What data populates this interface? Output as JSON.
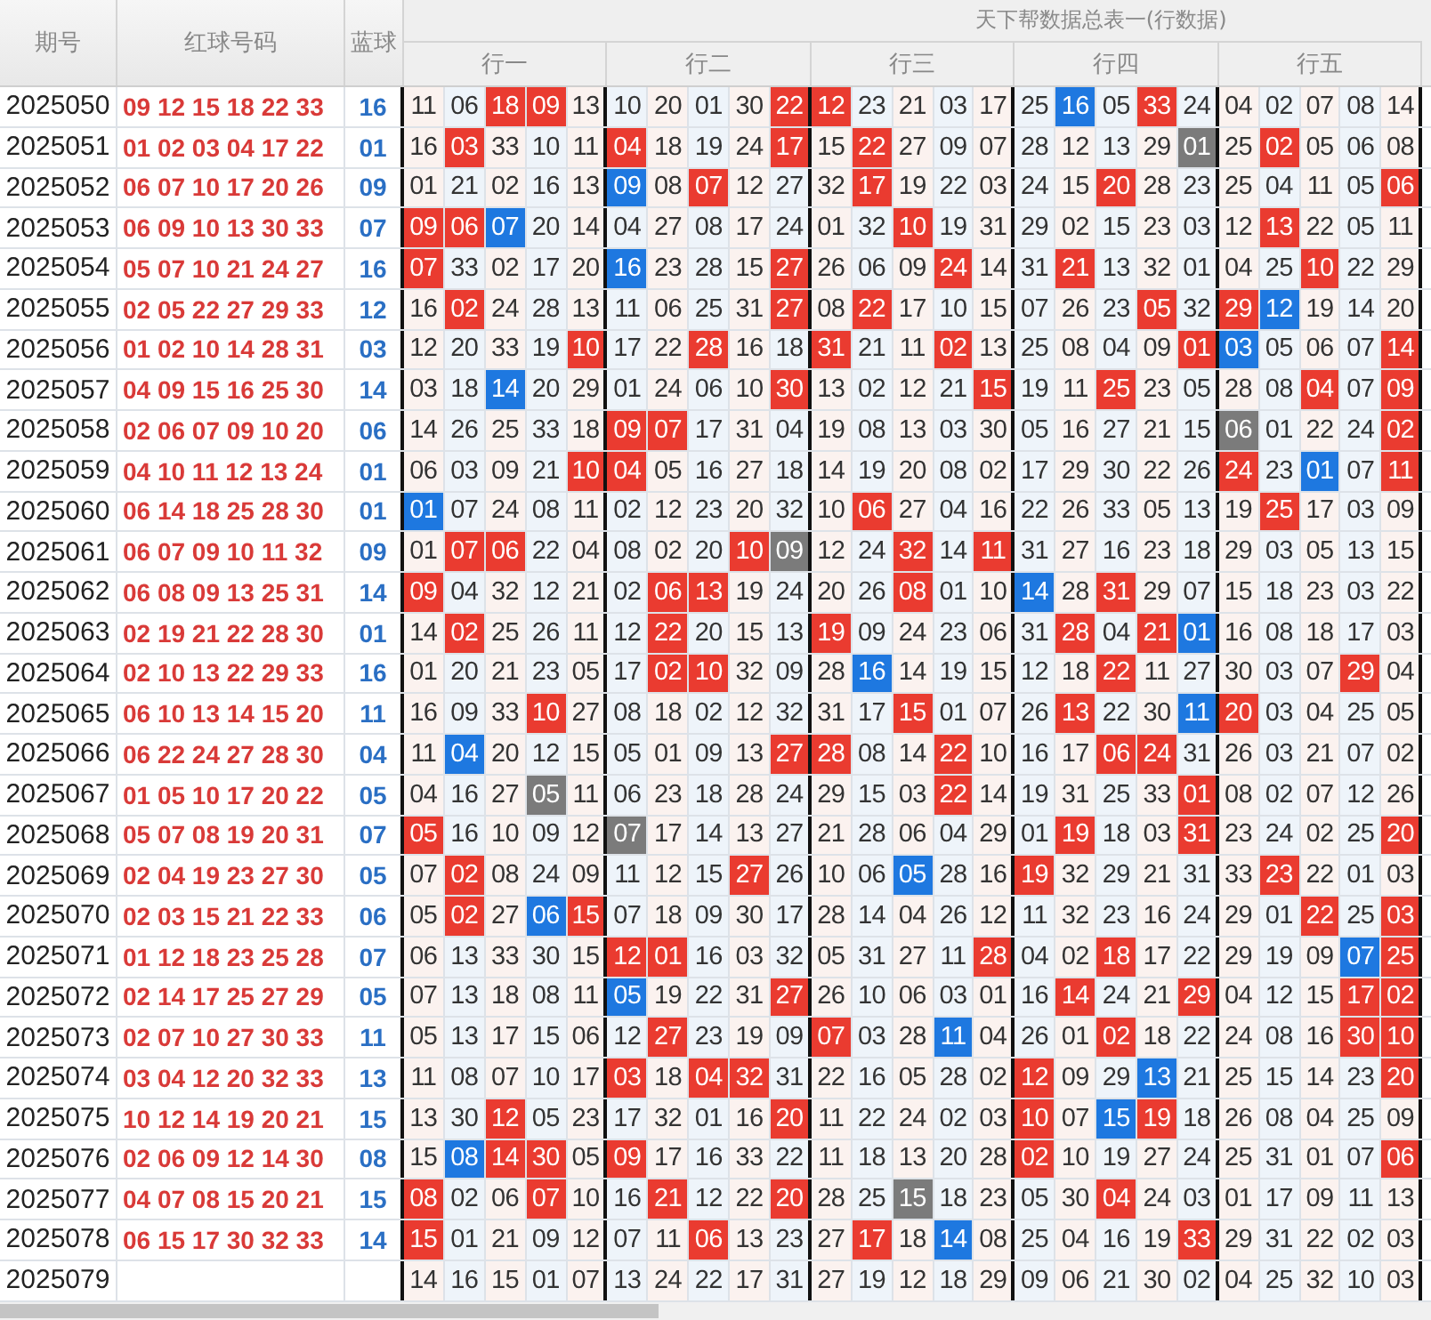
{
  "title": "天下帮数据总表一(行数据)",
  "columns": [
    "期号",
    "红球号码",
    "蓝球"
  ],
  "groups": [
    "行一",
    "行二",
    "行三",
    "行四",
    "行五"
  ],
  "rows": [
    {
      "issue": "2025050",
      "red": "09 12 15 18 22 33",
      "blue": "16",
      "cells": [
        {
          "v": "11"
        },
        {
          "v": "06"
        },
        {
          "v": "18",
          "red_hit": true
        },
        {
          "v": "09",
          "red_hit": true
        },
        {
          "v": "13"
        },
        {
          "v": "10"
        },
        {
          "v": "20"
        },
        {
          "v": "01"
        },
        {
          "v": "30"
        },
        {
          "v": "22",
          "red_hit": true
        },
        {
          "v": "12",
          "red_hit": true
        },
        {
          "v": "23"
        },
        {
          "v": "21"
        },
        {
          "v": "03"
        },
        {
          "v": "17"
        },
        {
          "v": "25"
        },
        {
          "v": "16",
          "blue_hit": true
        },
        {
          "v": "05"
        },
        {
          "v": "33",
          "red_hit": true
        },
        {
          "v": "24"
        },
        {
          "v": "04"
        },
        {
          "v": "02"
        },
        {
          "v": "07"
        },
        {
          "v": "08"
        },
        {
          "v": "14"
        }
      ]
    },
    {
      "issue": "2025051",
      "red": "01 02 03 04 17 22",
      "blue": "01",
      "cells": [
        {
          "v": "16"
        },
        {
          "v": "03",
          "red_hit": true
        },
        {
          "v": "33"
        },
        {
          "v": "10"
        },
        {
          "v": "11"
        },
        {
          "v": "04",
          "red_hit": true
        },
        {
          "v": "18"
        },
        {
          "v": "19"
        },
        {
          "v": "24"
        },
        {
          "v": "17",
          "red_hit": true
        },
        {
          "v": "15"
        },
        {
          "v": "22",
          "red_hit": true
        },
        {
          "v": "27"
        },
        {
          "v": "09"
        },
        {
          "v": "07"
        },
        {
          "v": "28"
        },
        {
          "v": "12"
        },
        {
          "v": "13"
        },
        {
          "v": "29"
        },
        {
          "v": "01",
          "gray_hit": true
        },
        {
          "v": "25"
        },
        {
          "v": "02",
          "red_hit": true
        },
        {
          "v": "05"
        },
        {
          "v": "06"
        },
        {
          "v": "08"
        }
      ]
    },
    {
      "issue": "2025052",
      "red": "06 07 10 17 20 26",
      "blue": "09",
      "cells": [
        {
          "v": "01"
        },
        {
          "v": "21"
        },
        {
          "v": "02"
        },
        {
          "v": "16"
        },
        {
          "v": "13"
        },
        {
          "v": "09",
          "blue_hit": true
        },
        {
          "v": "08"
        },
        {
          "v": "07",
          "red_hit": true
        },
        {
          "v": "12"
        },
        {
          "v": "27"
        },
        {
          "v": "32"
        },
        {
          "v": "17",
          "red_hit": true
        },
        {
          "v": "19"
        },
        {
          "v": "22"
        },
        {
          "v": "03"
        },
        {
          "v": "24"
        },
        {
          "v": "15"
        },
        {
          "v": "20",
          "red_hit": true
        },
        {
          "v": "28"
        },
        {
          "v": "23"
        },
        {
          "v": "25"
        },
        {
          "v": "04"
        },
        {
          "v": "11"
        },
        {
          "v": "05"
        },
        {
          "v": "06",
          "red_hit": true
        }
      ]
    },
    {
      "issue": "2025053",
      "red": "06 09 10 13 30 33",
      "blue": "07",
      "cells": [
        {
          "v": "09",
          "red_hit": true
        },
        {
          "v": "06",
          "red_hit": true
        },
        {
          "v": "07",
          "blue_hit": true
        },
        {
          "v": "20"
        },
        {
          "v": "14"
        },
        {
          "v": "04"
        },
        {
          "v": "27"
        },
        {
          "v": "08"
        },
        {
          "v": "17"
        },
        {
          "v": "24"
        },
        {
          "v": "01"
        },
        {
          "v": "32"
        },
        {
          "v": "10",
          "red_hit": true
        },
        {
          "v": "19"
        },
        {
          "v": "31"
        },
        {
          "v": "29"
        },
        {
          "v": "02"
        },
        {
          "v": "15"
        },
        {
          "v": "23"
        },
        {
          "v": "03"
        },
        {
          "v": "12"
        },
        {
          "v": "13",
          "red_hit": true
        },
        {
          "v": "22"
        },
        {
          "v": "05"
        },
        {
          "v": "11"
        }
      ]
    },
    {
      "issue": "2025054",
      "red": "05 07 10 21 24 27",
      "blue": "16",
      "cells": [
        {
          "v": "07",
          "red_hit": true
        },
        {
          "v": "33"
        },
        {
          "v": "02"
        },
        {
          "v": "17"
        },
        {
          "v": "20"
        },
        {
          "v": "16",
          "blue_hit": true
        },
        {
          "v": "23"
        },
        {
          "v": "28"
        },
        {
          "v": "15"
        },
        {
          "v": "27",
          "red_hit": true
        },
        {
          "v": "26"
        },
        {
          "v": "06"
        },
        {
          "v": "09"
        },
        {
          "v": "24",
          "red_hit": true
        },
        {
          "v": "14"
        },
        {
          "v": "31"
        },
        {
          "v": "21",
          "red_hit": true
        },
        {
          "v": "13"
        },
        {
          "v": "32"
        },
        {
          "v": "01"
        },
        {
          "v": "04"
        },
        {
          "v": "25"
        },
        {
          "v": "10",
          "red_hit": true
        },
        {
          "v": "22"
        },
        {
          "v": "29"
        }
      ]
    },
    {
      "issue": "2025055",
      "red": "02 05 22 27 29 33",
      "blue": "12",
      "cells": [
        {
          "v": "16"
        },
        {
          "v": "02",
          "red_hit": true
        },
        {
          "v": "24"
        },
        {
          "v": "28"
        },
        {
          "v": "13"
        },
        {
          "v": "11"
        },
        {
          "v": "06"
        },
        {
          "v": "25"
        },
        {
          "v": "31"
        },
        {
          "v": "27",
          "red_hit": true
        },
        {
          "v": "08"
        },
        {
          "v": "22",
          "red_hit": true
        },
        {
          "v": "17"
        },
        {
          "v": "10"
        },
        {
          "v": "15"
        },
        {
          "v": "07"
        },
        {
          "v": "26"
        },
        {
          "v": "23"
        },
        {
          "v": "05",
          "red_hit": true
        },
        {
          "v": "32"
        },
        {
          "v": "29",
          "red_hit": true
        },
        {
          "v": "12",
          "blue_hit": true
        },
        {
          "v": "19"
        },
        {
          "v": "14"
        },
        {
          "v": "20"
        }
      ]
    },
    {
      "issue": "2025056",
      "red": "01 02 10 14 28 31",
      "blue": "03",
      "cells": [
        {
          "v": "12"
        },
        {
          "v": "20"
        },
        {
          "v": "33"
        },
        {
          "v": "19"
        },
        {
          "v": "10",
          "red_hit": true
        },
        {
          "v": "17"
        },
        {
          "v": "22"
        },
        {
          "v": "28",
          "red_hit": true
        },
        {
          "v": "16"
        },
        {
          "v": "18"
        },
        {
          "v": "31",
          "red_hit": true
        },
        {
          "v": "21"
        },
        {
          "v": "11"
        },
        {
          "v": "02",
          "red_hit": true
        },
        {
          "v": "13"
        },
        {
          "v": "25"
        },
        {
          "v": "08"
        },
        {
          "v": "04"
        },
        {
          "v": "09"
        },
        {
          "v": "01",
          "red_hit": true
        },
        {
          "v": "03",
          "blue_hit": true
        },
        {
          "v": "05"
        },
        {
          "v": "06"
        },
        {
          "v": "07"
        },
        {
          "v": "14",
          "red_hit": true
        }
      ]
    },
    {
      "issue": "2025057",
      "red": "04 09 15 16 25 30",
      "blue": "14",
      "cells": [
        {
          "v": "03"
        },
        {
          "v": "18"
        },
        {
          "v": "14",
          "blue_hit": true
        },
        {
          "v": "20"
        },
        {
          "v": "29"
        },
        {
          "v": "01"
        },
        {
          "v": "24"
        },
        {
          "v": "06"
        },
        {
          "v": "10"
        },
        {
          "v": "30",
          "red_hit": true
        },
        {
          "v": "13"
        },
        {
          "v": "02"
        },
        {
          "v": "12"
        },
        {
          "v": "21"
        },
        {
          "v": "15",
          "red_hit": true
        },
        {
          "v": "19"
        },
        {
          "v": "11"
        },
        {
          "v": "25",
          "red_hit": true
        },
        {
          "v": "23"
        },
        {
          "v": "05"
        },
        {
          "v": "28"
        },
        {
          "v": "08"
        },
        {
          "v": "04",
          "red_hit": true
        },
        {
          "v": "07"
        },
        {
          "v": "09",
          "red_hit": true
        }
      ]
    },
    {
      "issue": "2025058",
      "red": "02 06 07 09 10 20",
      "blue": "06",
      "cells": [
        {
          "v": "14"
        },
        {
          "v": "26"
        },
        {
          "v": "25"
        },
        {
          "v": "33"
        },
        {
          "v": "18"
        },
        {
          "v": "09",
          "red_hit": true
        },
        {
          "v": "07",
          "red_hit": true
        },
        {
          "v": "17"
        },
        {
          "v": "31"
        },
        {
          "v": "04"
        },
        {
          "v": "19"
        },
        {
          "v": "08"
        },
        {
          "v": "13"
        },
        {
          "v": "03"
        },
        {
          "v": "30"
        },
        {
          "v": "05"
        },
        {
          "v": "16"
        },
        {
          "v": "27"
        },
        {
          "v": "21"
        },
        {
          "v": "15"
        },
        {
          "v": "06",
          "gray_hit": true
        },
        {
          "v": "01"
        },
        {
          "v": "22"
        },
        {
          "v": "24"
        },
        {
          "v": "02",
          "red_hit": true
        }
      ]
    },
    {
      "issue": "2025059",
      "red": "04 10 11 12 13 24",
      "blue": "01",
      "cells": [
        {
          "v": "06"
        },
        {
          "v": "03"
        },
        {
          "v": "09"
        },
        {
          "v": "21"
        },
        {
          "v": "10",
          "red_hit": true
        },
        {
          "v": "04",
          "red_hit": true
        },
        {
          "v": "05"
        },
        {
          "v": "16"
        },
        {
          "v": "27"
        },
        {
          "v": "18"
        },
        {
          "v": "14"
        },
        {
          "v": "19"
        },
        {
          "v": "20"
        },
        {
          "v": "08"
        },
        {
          "v": "02"
        },
        {
          "v": "17"
        },
        {
          "v": "29"
        },
        {
          "v": "30"
        },
        {
          "v": "22"
        },
        {
          "v": "26"
        },
        {
          "v": "24",
          "red_hit": true
        },
        {
          "v": "23"
        },
        {
          "v": "01",
          "blue_hit": true
        },
        {
          "v": "07"
        },
        {
          "v": "11",
          "red_hit": true
        }
      ]
    },
    {
      "issue": "2025060",
      "red": "06 14 18 25 28 30",
      "blue": "01",
      "cells": [
        {
          "v": "01",
          "blue_hit": true
        },
        {
          "v": "07"
        },
        {
          "v": "24"
        },
        {
          "v": "08"
        },
        {
          "v": "11"
        },
        {
          "v": "02"
        },
        {
          "v": "12"
        },
        {
          "v": "23"
        },
        {
          "v": "20"
        },
        {
          "v": "32"
        },
        {
          "v": "10"
        },
        {
          "v": "06",
          "red_hit": true
        },
        {
          "v": "27"
        },
        {
          "v": "04"
        },
        {
          "v": "16"
        },
        {
          "v": "22"
        },
        {
          "v": "26"
        },
        {
          "v": "33"
        },
        {
          "v": "05"
        },
        {
          "v": "13"
        },
        {
          "v": "19"
        },
        {
          "v": "25",
          "red_hit": true
        },
        {
          "v": "17"
        },
        {
          "v": "03"
        },
        {
          "v": "09"
        }
      ]
    },
    {
      "issue": "2025061",
      "red": "06 07 09 10 11 32",
      "blue": "09",
      "cells": [
        {
          "v": "01"
        },
        {
          "v": "07",
          "red_hit": true
        },
        {
          "v": "06",
          "red_hit": true
        },
        {
          "v": "22"
        },
        {
          "v": "04"
        },
        {
          "v": "08"
        },
        {
          "v": "02"
        },
        {
          "v": "20"
        },
        {
          "v": "10",
          "red_hit": true
        },
        {
          "v": "09",
          "gray_hit": true
        },
        {
          "v": "12"
        },
        {
          "v": "24"
        },
        {
          "v": "32",
          "red_hit": true
        },
        {
          "v": "14"
        },
        {
          "v": "11",
          "red_hit": true
        },
        {
          "v": "31"
        },
        {
          "v": "27"
        },
        {
          "v": "16"
        },
        {
          "v": "23"
        },
        {
          "v": "18"
        },
        {
          "v": "29"
        },
        {
          "v": "03"
        },
        {
          "v": "05"
        },
        {
          "v": "13"
        },
        {
          "v": "15"
        }
      ]
    },
    {
      "issue": "2025062",
      "red": "06 08 09 13 25 31",
      "blue": "14",
      "cells": [
        {
          "v": "09",
          "red_hit": true
        },
        {
          "v": "04"
        },
        {
          "v": "32"
        },
        {
          "v": "12"
        },
        {
          "v": "21"
        },
        {
          "v": "02"
        },
        {
          "v": "06",
          "red_hit": true
        },
        {
          "v": "13",
          "red_hit": true
        },
        {
          "v": "19"
        },
        {
          "v": "24"
        },
        {
          "v": "20"
        },
        {
          "v": "26"
        },
        {
          "v": "08",
          "red_hit": true
        },
        {
          "v": "01"
        },
        {
          "v": "10"
        },
        {
          "v": "14",
          "blue_hit": true
        },
        {
          "v": "28"
        },
        {
          "v": "31",
          "red_hit": true
        },
        {
          "v": "29"
        },
        {
          "v": "07"
        },
        {
          "v": "15"
        },
        {
          "v": "18"
        },
        {
          "v": "23"
        },
        {
          "v": "03"
        },
        {
          "v": "22"
        }
      ]
    },
    {
      "issue": "2025063",
      "red": "02 19 21 22 28 30",
      "blue": "01",
      "cells": [
        {
          "v": "14"
        },
        {
          "v": "02",
          "red_hit": true
        },
        {
          "v": "25"
        },
        {
          "v": "26"
        },
        {
          "v": "11"
        },
        {
          "v": "12"
        },
        {
          "v": "22",
          "red_hit": true
        },
        {
          "v": "20"
        },
        {
          "v": "15"
        },
        {
          "v": "13"
        },
        {
          "v": "19",
          "red_hit": true
        },
        {
          "v": "09"
        },
        {
          "v": "24"
        },
        {
          "v": "23"
        },
        {
          "v": "06"
        },
        {
          "v": "31"
        },
        {
          "v": "28",
          "red_hit": true
        },
        {
          "v": "04"
        },
        {
          "v": "21",
          "red_hit": true
        },
        {
          "v": "01",
          "blue_hit": true
        },
        {
          "v": "16"
        },
        {
          "v": "08"
        },
        {
          "v": "18"
        },
        {
          "v": "17"
        },
        {
          "v": "03"
        }
      ]
    },
    {
      "issue": "2025064",
      "red": "02 10 13 22 29 33",
      "blue": "16",
      "cells": [
        {
          "v": "01"
        },
        {
          "v": "20"
        },
        {
          "v": "21"
        },
        {
          "v": "23"
        },
        {
          "v": "05"
        },
        {
          "v": "17"
        },
        {
          "v": "02",
          "red_hit": true
        },
        {
          "v": "10",
          "red_hit": true
        },
        {
          "v": "32"
        },
        {
          "v": "09"
        },
        {
          "v": "28"
        },
        {
          "v": "16",
          "blue_hit": true
        },
        {
          "v": "14"
        },
        {
          "v": "19"
        },
        {
          "v": "15"
        },
        {
          "v": "12"
        },
        {
          "v": "18"
        },
        {
          "v": "22",
          "red_hit": true
        },
        {
          "v": "11"
        },
        {
          "v": "27"
        },
        {
          "v": "30"
        },
        {
          "v": "03"
        },
        {
          "v": "07"
        },
        {
          "v": "29",
          "red_hit": true
        },
        {
          "v": "04"
        }
      ]
    },
    {
      "issue": "2025065",
      "red": "06 10 13 14 15 20",
      "blue": "11",
      "cells": [
        {
          "v": "16"
        },
        {
          "v": "09"
        },
        {
          "v": "33"
        },
        {
          "v": "10",
          "red_hit": true
        },
        {
          "v": "27"
        },
        {
          "v": "08"
        },
        {
          "v": "18"
        },
        {
          "v": "02"
        },
        {
          "v": "12"
        },
        {
          "v": "32"
        },
        {
          "v": "31"
        },
        {
          "v": "17"
        },
        {
          "v": "15",
          "red_hit": true
        },
        {
          "v": "01"
        },
        {
          "v": "07"
        },
        {
          "v": "26"
        },
        {
          "v": "13",
          "red_hit": true
        },
        {
          "v": "22"
        },
        {
          "v": "30"
        },
        {
          "v": "11",
          "blue_hit": true
        },
        {
          "v": "20",
          "red_hit": true
        },
        {
          "v": "03"
        },
        {
          "v": "04"
        },
        {
          "v": "25"
        },
        {
          "v": "05"
        }
      ]
    },
    {
      "issue": "2025066",
      "red": "06 22 24 27 28 30",
      "blue": "04",
      "cells": [
        {
          "v": "11"
        },
        {
          "v": "04",
          "blue_hit": true
        },
        {
          "v": "20"
        },
        {
          "v": "12"
        },
        {
          "v": "15"
        },
        {
          "v": "05"
        },
        {
          "v": "01"
        },
        {
          "v": "09"
        },
        {
          "v": "13"
        },
        {
          "v": "27",
          "red_hit": true
        },
        {
          "v": "28",
          "red_hit": true
        },
        {
          "v": "08"
        },
        {
          "v": "14"
        },
        {
          "v": "22",
          "red_hit": true
        },
        {
          "v": "10"
        },
        {
          "v": "16"
        },
        {
          "v": "17"
        },
        {
          "v": "06",
          "red_hit": true
        },
        {
          "v": "24",
          "red_hit": true
        },
        {
          "v": "31"
        },
        {
          "v": "26"
        },
        {
          "v": "03"
        },
        {
          "v": "21"
        },
        {
          "v": "07"
        },
        {
          "v": "02"
        }
      ]
    },
    {
      "issue": "2025067",
      "red": "01 05 10 17 20 22",
      "blue": "05",
      "cells": [
        {
          "v": "04"
        },
        {
          "v": "16"
        },
        {
          "v": "27"
        },
        {
          "v": "05",
          "gray_hit": true
        },
        {
          "v": "11"
        },
        {
          "v": "06"
        },
        {
          "v": "23"
        },
        {
          "v": "18"
        },
        {
          "v": "28"
        },
        {
          "v": "24"
        },
        {
          "v": "29"
        },
        {
          "v": "15"
        },
        {
          "v": "03"
        },
        {
          "v": "22",
          "red_hit": true
        },
        {
          "v": "14"
        },
        {
          "v": "19"
        },
        {
          "v": "31"
        },
        {
          "v": "25"
        },
        {
          "v": "33"
        },
        {
          "v": "01",
          "red_hit": true
        },
        {
          "v": "08"
        },
        {
          "v": "02"
        },
        {
          "v": "07"
        },
        {
          "v": "12"
        },
        {
          "v": "26"
        }
      ]
    },
    {
      "issue": "2025068",
      "red": "05 07 08 19 20 31",
      "blue": "07",
      "cells": [
        {
          "v": "05",
          "red_hit": true
        },
        {
          "v": "16"
        },
        {
          "v": "10"
        },
        {
          "v": "09"
        },
        {
          "v": "12"
        },
        {
          "v": "07",
          "gray_hit": true
        },
        {
          "v": "17"
        },
        {
          "v": "14"
        },
        {
          "v": "13"
        },
        {
          "v": "27"
        },
        {
          "v": "21"
        },
        {
          "v": "28"
        },
        {
          "v": "06"
        },
        {
          "v": "04"
        },
        {
          "v": "29"
        },
        {
          "v": "01"
        },
        {
          "v": "19",
          "red_hit": true
        },
        {
          "v": "18"
        },
        {
          "v": "03"
        },
        {
          "v": "31",
          "red_hit": true
        },
        {
          "v": "23"
        },
        {
          "v": "24"
        },
        {
          "v": "02"
        },
        {
          "v": "25"
        },
        {
          "v": "20",
          "red_hit": true
        }
      ]
    },
    {
      "issue": "2025069",
      "red": "02 04 19 23 27 30",
      "blue": "05",
      "cells": [
        {
          "v": "07"
        },
        {
          "v": "02",
          "red_hit": true
        },
        {
          "v": "08"
        },
        {
          "v": "24"
        },
        {
          "v": "09"
        },
        {
          "v": "11"
        },
        {
          "v": "12"
        },
        {
          "v": "15"
        },
        {
          "v": "27",
          "red_hit": true
        },
        {
          "v": "26"
        },
        {
          "v": "10"
        },
        {
          "v": "06"
        },
        {
          "v": "05",
          "blue_hit": true
        },
        {
          "v": "28"
        },
        {
          "v": "16"
        },
        {
          "v": "19",
          "red_hit": true
        },
        {
          "v": "32"
        },
        {
          "v": "29"
        },
        {
          "v": "21"
        },
        {
          "v": "31"
        },
        {
          "v": "33"
        },
        {
          "v": "23",
          "red_hit": true
        },
        {
          "v": "22"
        },
        {
          "v": "01"
        },
        {
          "v": "03"
        }
      ]
    },
    {
      "issue": "2025070",
      "red": "02 03 15 21 22 33",
      "blue": "06",
      "cells": [
        {
          "v": "05"
        },
        {
          "v": "02",
          "red_hit": true
        },
        {
          "v": "27"
        },
        {
          "v": "06",
          "blue_hit": true
        },
        {
          "v": "15",
          "red_hit": true
        },
        {
          "v": "07"
        },
        {
          "v": "18"
        },
        {
          "v": "09"
        },
        {
          "v": "30"
        },
        {
          "v": "17"
        },
        {
          "v": "28"
        },
        {
          "v": "14"
        },
        {
          "v": "04"
        },
        {
          "v": "26"
        },
        {
          "v": "12"
        },
        {
          "v": "11"
        },
        {
          "v": "32"
        },
        {
          "v": "23"
        },
        {
          "v": "16"
        },
        {
          "v": "24"
        },
        {
          "v": "29"
        },
        {
          "v": "01"
        },
        {
          "v": "22",
          "red_hit": true
        },
        {
          "v": "25"
        },
        {
          "v": "03",
          "red_hit": true
        }
      ]
    },
    {
      "issue": "2025071",
      "red": "01 12 18 23 25 28",
      "blue": "07",
      "cells": [
        {
          "v": "06"
        },
        {
          "v": "13"
        },
        {
          "v": "33"
        },
        {
          "v": "30"
        },
        {
          "v": "15"
        },
        {
          "v": "12",
          "red_hit": true
        },
        {
          "v": "01",
          "red_hit": true
        },
        {
          "v": "16"
        },
        {
          "v": "03"
        },
        {
          "v": "32"
        },
        {
          "v": "05"
        },
        {
          "v": "31"
        },
        {
          "v": "27"
        },
        {
          "v": "11"
        },
        {
          "v": "28",
          "red_hit": true
        },
        {
          "v": "04"
        },
        {
          "v": "02"
        },
        {
          "v": "18",
          "red_hit": true
        },
        {
          "v": "17"
        },
        {
          "v": "22"
        },
        {
          "v": "29"
        },
        {
          "v": "19"
        },
        {
          "v": "09"
        },
        {
          "v": "07",
          "blue_hit": true
        },
        {
          "v": "25",
          "red_hit": true
        }
      ]
    },
    {
      "issue": "2025072",
      "red": "02 14 17 25 27 29",
      "blue": "05",
      "cells": [
        {
          "v": "07"
        },
        {
          "v": "13"
        },
        {
          "v": "18"
        },
        {
          "v": "08"
        },
        {
          "v": "11"
        },
        {
          "v": "05",
          "blue_hit": true
        },
        {
          "v": "19"
        },
        {
          "v": "22"
        },
        {
          "v": "31"
        },
        {
          "v": "27",
          "red_hit": true
        },
        {
          "v": "26"
        },
        {
          "v": "10"
        },
        {
          "v": "06"
        },
        {
          "v": "03"
        },
        {
          "v": "01"
        },
        {
          "v": "16"
        },
        {
          "v": "14",
          "red_hit": true
        },
        {
          "v": "24"
        },
        {
          "v": "21"
        },
        {
          "v": "29",
          "red_hit": true
        },
        {
          "v": "04"
        },
        {
          "v": "12"
        },
        {
          "v": "15"
        },
        {
          "v": "17",
          "red_hit": true
        },
        {
          "v": "02",
          "red_hit": true
        }
      ]
    },
    {
      "issue": "2025073",
      "red": "02 07 10 27 30 33",
      "blue": "11",
      "cells": [
        {
          "v": "05"
        },
        {
          "v": "13"
        },
        {
          "v": "17"
        },
        {
          "v": "15"
        },
        {
          "v": "06"
        },
        {
          "v": "12"
        },
        {
          "v": "27",
          "red_hit": true
        },
        {
          "v": "23"
        },
        {
          "v": "19"
        },
        {
          "v": "09"
        },
        {
          "v": "07",
          "red_hit": true
        },
        {
          "v": "03"
        },
        {
          "v": "28"
        },
        {
          "v": "11",
          "blue_hit": true
        },
        {
          "v": "04"
        },
        {
          "v": "26"
        },
        {
          "v": "01"
        },
        {
          "v": "02",
          "red_hit": true
        },
        {
          "v": "18"
        },
        {
          "v": "22"
        },
        {
          "v": "24"
        },
        {
          "v": "08"
        },
        {
          "v": "16"
        },
        {
          "v": "30",
          "red_hit": true
        },
        {
          "v": "10",
          "red_hit": true
        }
      ]
    },
    {
      "issue": "2025074",
      "red": "03 04 12 20 32 33",
      "blue": "13",
      "cells": [
        {
          "v": "11"
        },
        {
          "v": "08"
        },
        {
          "v": "07"
        },
        {
          "v": "10"
        },
        {
          "v": "17"
        },
        {
          "v": "03",
          "red_hit": true
        },
        {
          "v": "18"
        },
        {
          "v": "04",
          "red_hit": true
        },
        {
          "v": "32",
          "red_hit": true
        },
        {
          "v": "31"
        },
        {
          "v": "22"
        },
        {
          "v": "16"
        },
        {
          "v": "05"
        },
        {
          "v": "28"
        },
        {
          "v": "02"
        },
        {
          "v": "12",
          "red_hit": true
        },
        {
          "v": "09"
        },
        {
          "v": "29"
        },
        {
          "v": "13",
          "blue_hit": true
        },
        {
          "v": "21"
        },
        {
          "v": "25"
        },
        {
          "v": "15"
        },
        {
          "v": "14"
        },
        {
          "v": "23"
        },
        {
          "v": "20",
          "red_hit": true
        }
      ]
    },
    {
      "issue": "2025075",
      "red": "10 12 14 19 20 21",
      "blue": "15",
      "cells": [
        {
          "v": "13"
        },
        {
          "v": "30"
        },
        {
          "v": "12",
          "red_hit": true
        },
        {
          "v": "05"
        },
        {
          "v": "23"
        },
        {
          "v": "17"
        },
        {
          "v": "32"
        },
        {
          "v": "01"
        },
        {
          "v": "16"
        },
        {
          "v": "20",
          "red_hit": true
        },
        {
          "v": "11"
        },
        {
          "v": "22"
        },
        {
          "v": "24"
        },
        {
          "v": "02"
        },
        {
          "v": "03"
        },
        {
          "v": "10",
          "red_hit": true
        },
        {
          "v": "07"
        },
        {
          "v": "15",
          "blue_hit": true
        },
        {
          "v": "19",
          "red_hit": true
        },
        {
          "v": "18"
        },
        {
          "v": "26"
        },
        {
          "v": "08"
        },
        {
          "v": "04"
        },
        {
          "v": "25"
        },
        {
          "v": "09"
        }
      ]
    },
    {
      "issue": "2025076",
      "red": "02 06 09 12 14 30",
      "blue": "08",
      "cells": [
        {
          "v": "15"
        },
        {
          "v": "08",
          "blue_hit": true
        },
        {
          "v": "14",
          "red_hit": true
        },
        {
          "v": "30",
          "red_hit": true
        },
        {
          "v": "05"
        },
        {
          "v": "09",
          "red_hit": true
        },
        {
          "v": "17"
        },
        {
          "v": "16"
        },
        {
          "v": "33"
        },
        {
          "v": "22"
        },
        {
          "v": "11"
        },
        {
          "v": "18"
        },
        {
          "v": "13"
        },
        {
          "v": "20"
        },
        {
          "v": "28"
        },
        {
          "v": "02",
          "red_hit": true
        },
        {
          "v": "10"
        },
        {
          "v": "19"
        },
        {
          "v": "27"
        },
        {
          "v": "24"
        },
        {
          "v": "25"
        },
        {
          "v": "31"
        },
        {
          "v": "01"
        },
        {
          "v": "07"
        },
        {
          "v": "06",
          "red_hit": true
        }
      ]
    },
    {
      "issue": "2025077",
      "red": "04 07 08 15 20 21",
      "blue": "15",
      "cells": [
        {
          "v": "08",
          "red_hit": true
        },
        {
          "v": "02"
        },
        {
          "v": "06"
        },
        {
          "v": "07",
          "red_hit": true
        },
        {
          "v": "10"
        },
        {
          "v": "16"
        },
        {
          "v": "21",
          "red_hit": true
        },
        {
          "v": "12"
        },
        {
          "v": "22"
        },
        {
          "v": "20",
          "red_hit": true
        },
        {
          "v": "28"
        },
        {
          "v": "25"
        },
        {
          "v": "15",
          "gray_hit": true
        },
        {
          "v": "18"
        },
        {
          "v": "23"
        },
        {
          "v": "05"
        },
        {
          "v": "30"
        },
        {
          "v": "04",
          "red_hit": true
        },
        {
          "v": "24"
        },
        {
          "v": "03"
        },
        {
          "v": "01"
        },
        {
          "v": "17"
        },
        {
          "v": "09"
        },
        {
          "v": "11"
        },
        {
          "v": "13"
        }
      ]
    },
    {
      "issue": "2025078",
      "red": "06 15 17 30 32 33",
      "blue": "14",
      "cells": [
        {
          "v": "15",
          "red_hit": true
        },
        {
          "v": "01"
        },
        {
          "v": "21"
        },
        {
          "v": "09"
        },
        {
          "v": "12"
        },
        {
          "v": "07"
        },
        {
          "v": "11"
        },
        {
          "v": "06",
          "red_hit": true
        },
        {
          "v": "13"
        },
        {
          "v": "23"
        },
        {
          "v": "27"
        },
        {
          "v": "17",
          "red_hit": true
        },
        {
          "v": "18"
        },
        {
          "v": "14",
          "blue_hit": true
        },
        {
          "v": "08"
        },
        {
          "v": "25"
        },
        {
          "v": "04"
        },
        {
          "v": "16"
        },
        {
          "v": "19"
        },
        {
          "v": "33",
          "red_hit": true
        },
        {
          "v": "29"
        },
        {
          "v": "31"
        },
        {
          "v": "22"
        },
        {
          "v": "02"
        },
        {
          "v": "03"
        }
      ]
    },
    {
      "issue": "2025079",
      "cells": [
        {
          "v": "14"
        },
        {
          "v": "16"
        },
        {
          "v": "15"
        },
        {
          "v": "01"
        },
        {
          "v": "07"
        },
        {
          "v": "13"
        },
        {
          "v": "24"
        },
        {
          "v": "22"
        },
        {
          "v": "17"
        },
        {
          "v": "31"
        },
        {
          "v": "27"
        },
        {
          "v": "19"
        },
        {
          "v": "12"
        },
        {
          "v": "18"
        },
        {
          "v": "29"
        },
        {
          "v": "09"
        },
        {
          "v": "06"
        },
        {
          "v": "21"
        },
        {
          "v": "30"
        },
        {
          "v": "02"
        },
        {
          "v": "04"
        },
        {
          "v": "25"
        },
        {
          "v": "32"
        },
        {
          "v": "10"
        },
        {
          "v": "03"
        }
      ]
    }
  ]
}
